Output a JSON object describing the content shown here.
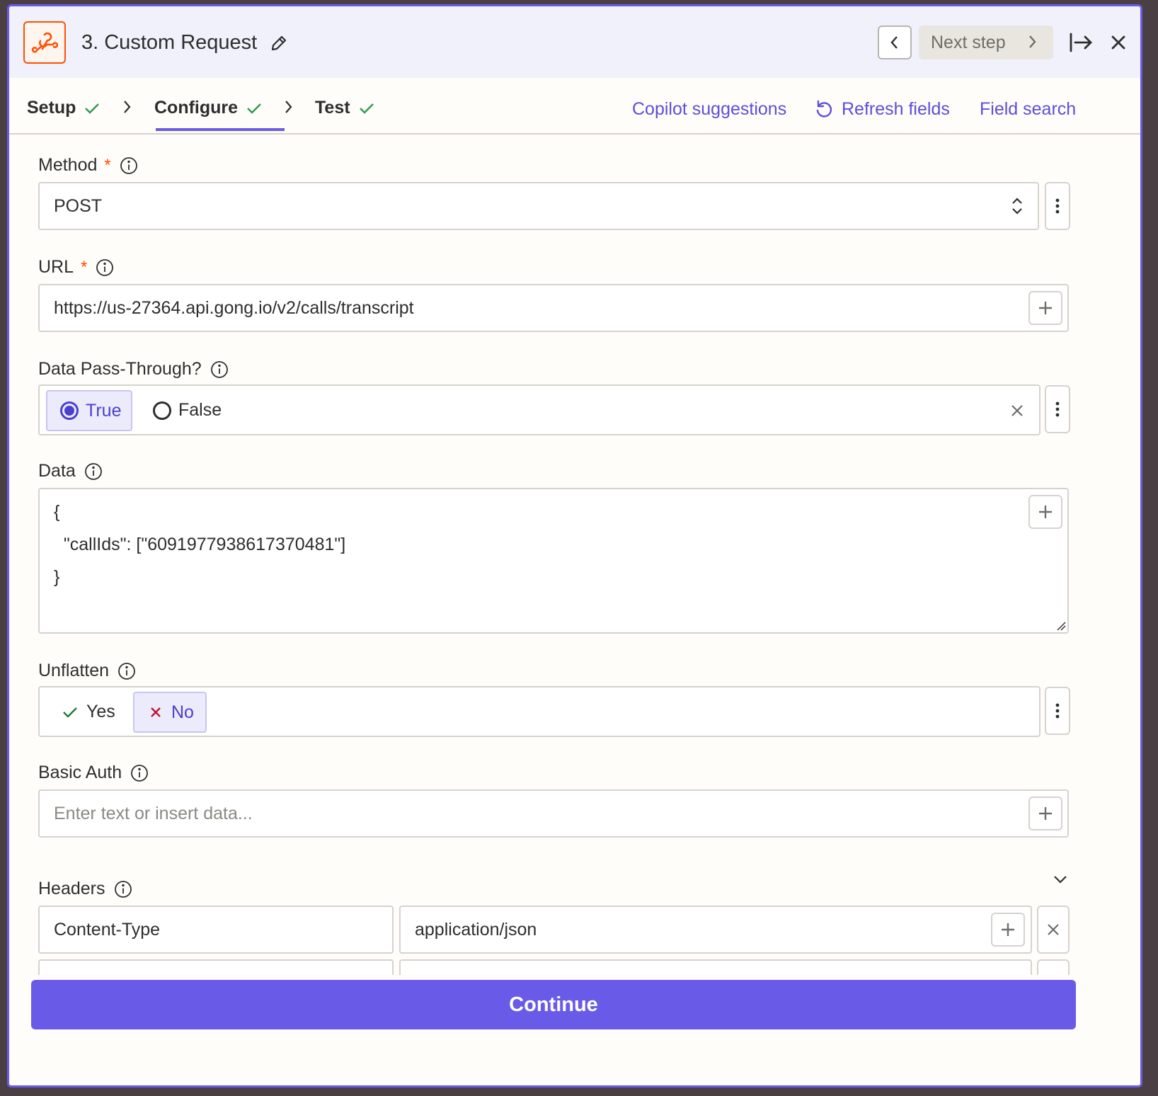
{
  "header": {
    "title": "3. Custom Request",
    "next_step_label": "Next step"
  },
  "tabs": [
    {
      "label": "Setup"
    },
    {
      "label": "Configure"
    },
    {
      "label": "Test"
    }
  ],
  "tab_links": {
    "copilot": "Copilot suggestions",
    "refresh": "Refresh fields",
    "field_search": "Field search"
  },
  "fields": {
    "method": {
      "label": "Method",
      "required": "*",
      "value": "POST"
    },
    "url": {
      "label": "URL",
      "required": "*",
      "value": "https://us-27364.api.gong.io/v2/calls/transcript"
    },
    "data_pass_through": {
      "label": "Data Pass-Through?",
      "options": [
        "True",
        "False"
      ],
      "selected": "True"
    },
    "data": {
      "label": "Data",
      "lines": [
        "{",
        "  \"callIds\": [\"6091977938617370481\"]",
        "}"
      ]
    },
    "unflatten": {
      "label": "Unflatten",
      "options": [
        "Yes",
        "No"
      ],
      "selected": "No"
    },
    "basic_auth": {
      "label": "Basic Auth",
      "placeholder": "Enter text or insert data..."
    },
    "headers": {
      "label": "Headers",
      "rows": [
        {
          "key": "Content-Type",
          "value": "application/json"
        }
      ]
    }
  },
  "footer": {
    "continue_label": "Continue"
  },
  "colors": {
    "accent": "#695be8",
    "brand": "#ff4f00",
    "success": "#2d9b4e"
  }
}
